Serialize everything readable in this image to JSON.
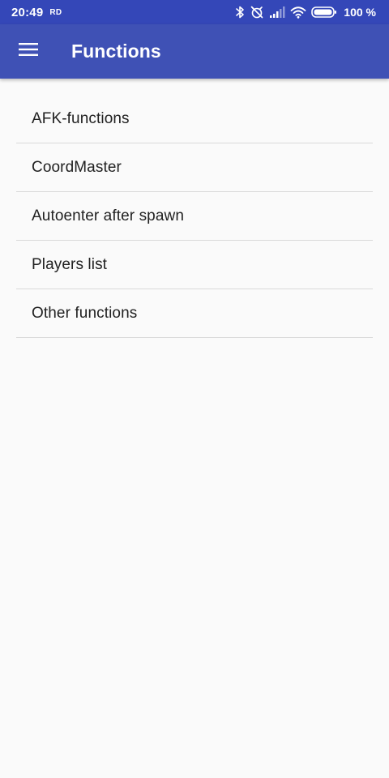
{
  "status_bar": {
    "time": "20:49",
    "badge": "RD",
    "battery_percent": "100 %",
    "icons": [
      "bluetooth-icon",
      "alarm-off-icon",
      "signal-icon",
      "wifi-icon",
      "battery-icon"
    ]
  },
  "app_bar": {
    "menu_icon": "hamburger-menu-icon",
    "title": "Functions"
  },
  "functions": {
    "items": [
      {
        "label": "AFK-functions"
      },
      {
        "label": "CoordMaster"
      },
      {
        "label": "Autoenter after spawn"
      },
      {
        "label": "Players list"
      },
      {
        "label": "Other functions"
      }
    ]
  },
  "colors": {
    "status_bar": "#3447b8",
    "app_bar": "#3f51b5",
    "background": "#fafafa",
    "divider": "#d9d9d9",
    "text_primary": "#212121"
  }
}
